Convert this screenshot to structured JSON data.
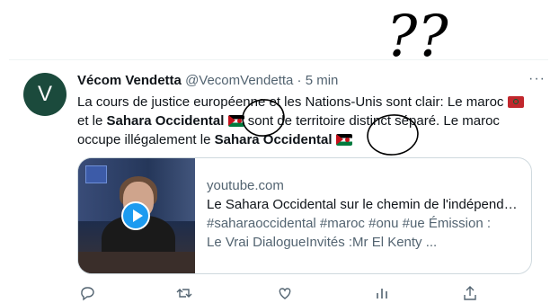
{
  "tweet": {
    "avatar_letter": "V",
    "display_name": "Vécom Vendetta",
    "handle": "@VecomVendetta",
    "separator": "·",
    "time": "5 min",
    "more_label": "···",
    "text": {
      "p1": "La cours de justice européenne et les Nations-Unis sont clair: Le maroc",
      "p2": "et le",
      "bold1": "Sahara Occidental",
      "p3": "sont de territoire distinct séparé. Le maroc occupe illégalement le",
      "bold2": "Sahara Occidental"
    },
    "flags": [
      "flag-morocco-icon",
      "flag-western-sahara-icon",
      "flag-western-sahara-icon"
    ]
  },
  "card": {
    "domain": "youtube.com",
    "title": "Le Sahara Occidental sur le chemin de l'indépendance",
    "desc_line1": "#saharaoccidental #maroc #onu #ue Émission :",
    "desc_line2": "Le Vrai DialogueInvités :Mr El Kenty ..."
  },
  "annotation": {
    "text": "??",
    "color": "#000000"
  },
  "colors": {
    "text": "#0f1419",
    "secondary": "#536471",
    "border": "#cfd9de",
    "play": "#1d9bf0",
    "avatar_bg": "#1b4a3c"
  }
}
